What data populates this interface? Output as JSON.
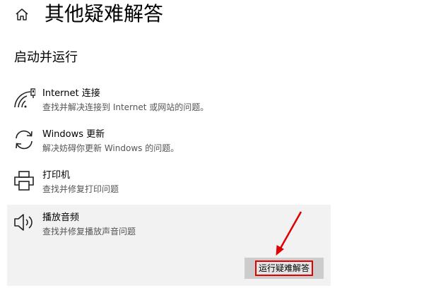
{
  "page": {
    "title": "其他疑难解答",
    "section_heading": "启动并运行"
  },
  "items": [
    {
      "name": "Internet 连接",
      "description": "查找并解决连接到 Internet 或网站的问题。",
      "icon": "wifi-icon"
    },
    {
      "name": "Windows 更新",
      "description": "解决妨碍你更新 Windows 的问题。",
      "icon": "refresh-icon"
    },
    {
      "name": "打印机",
      "description": "查找并修复打印问题",
      "icon": "printer-icon"
    },
    {
      "name": "播放音频",
      "description": "查找并修复播放声音问题",
      "icon": "speaker-icon"
    }
  ],
  "run_button": {
    "label": "运行疑难解答"
  },
  "colors": {
    "selected_background": "#f2f2f2",
    "button_background": "#cccccc",
    "annotation_red": "#e10000"
  }
}
